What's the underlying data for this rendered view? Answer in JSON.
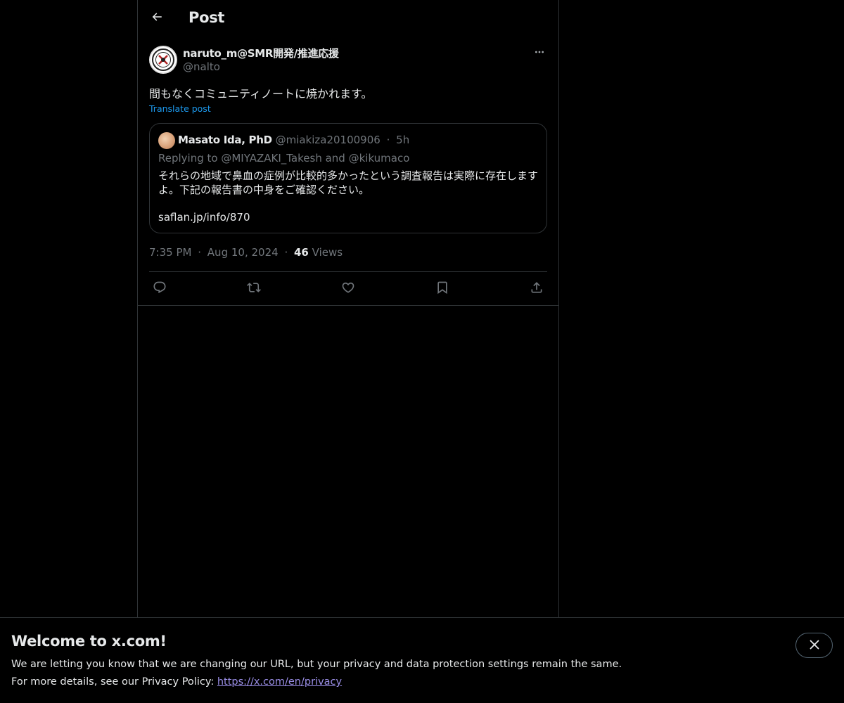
{
  "header": {
    "title": "Post"
  },
  "post": {
    "author": {
      "display_name": "naruto_m@SMR開発/推進応援",
      "handle": "@nalto"
    },
    "text": "間もなくコミュニティノートに焼かれます。",
    "translate_label": "Translate post",
    "quote": {
      "author_name": "Masato Ida, PhD",
      "author_handle": "@miakiza20100906",
      "separator": "·",
      "time_ago": "5h",
      "replying_to": "Replying to @MIYAZAKI_Takesh and @kikumaco",
      "body": "それらの地域で鼻血の症例が比較的多かったという調査報告は実際に存在しますよ。下記の報告書の中身をご確認ください。",
      "link": "saflan.jp/info/870"
    },
    "meta": {
      "time": "7:35 PM",
      "date": "Aug 10, 2024",
      "separator": "·",
      "views_count": "46",
      "views_label": "Views"
    },
    "icons": {
      "more": "more-horizontal-icon",
      "reply": "reply-icon",
      "repost": "repost-icon",
      "like": "like-icon",
      "bookmark": "bookmark-icon",
      "share": "share-icon"
    }
  },
  "banner": {
    "title": "Welcome to x.com!",
    "line1": "We are letting you know that we are changing our URL, but your privacy and data protection settings remain the same.",
    "line2_prefix": "For more details, see our Privacy Policy: ",
    "link_text": "https://x.com/en/privacy"
  },
  "colors": {
    "background": "#000000",
    "text": "#e7e9ea",
    "muted": "#71767b",
    "accent": "#1d9bf0",
    "border": "#2f3336",
    "link_purple": "#9a8ee6"
  }
}
